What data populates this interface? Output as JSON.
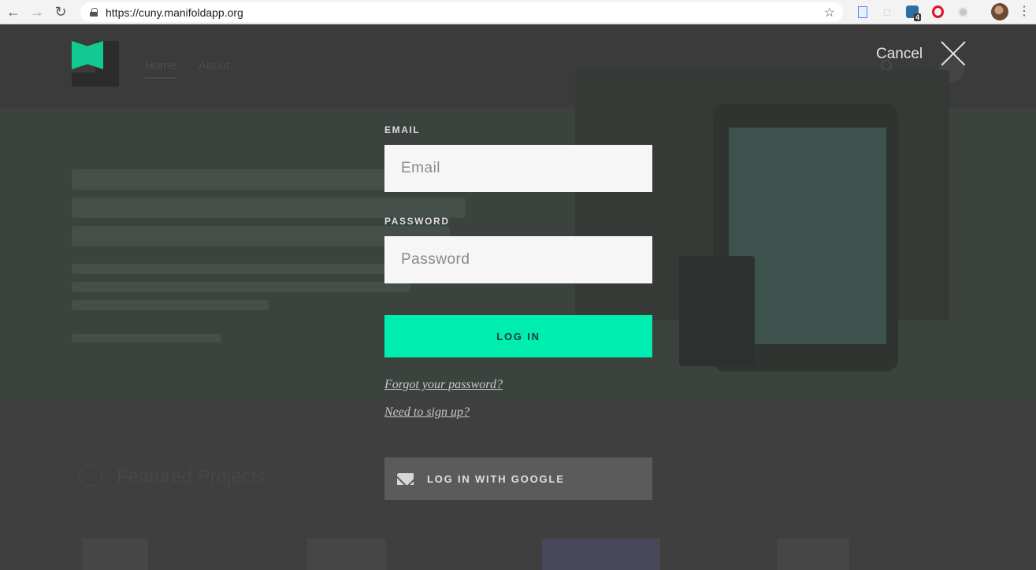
{
  "browser": {
    "url": "https://cuny.manifoldapp.org",
    "extensions": [
      "doc-icon",
      "chat-icon",
      "trello-icon",
      "opera-icon",
      "gray-circle-icon"
    ],
    "trello_badge": "4"
  },
  "site": {
    "nav": {
      "home": "Home",
      "about": "About"
    },
    "featured_heading": "Featured Projects"
  },
  "overlay": {
    "cancel_label": "Cancel",
    "email_label": "EMAIL",
    "email_placeholder": "Email",
    "email_value": "",
    "password_label": "PASSWORD",
    "password_placeholder": "Password",
    "password_value": "",
    "login_label": "LOG IN",
    "forgot_link": "Forgot your password?",
    "signup_link": "Need to sign up?",
    "google_label": "LOG IN WITH GOOGLE"
  },
  "colors": {
    "accent": "#00edb0",
    "overlay_bg": "#3f3f3f",
    "google_btn": "#5b5b5b"
  }
}
